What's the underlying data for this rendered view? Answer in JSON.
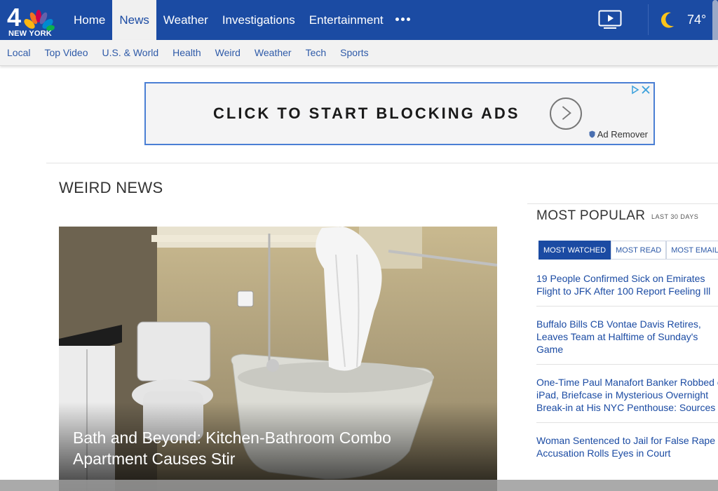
{
  "brand": {
    "logo_number": "4",
    "logo_city": "NEW YORK"
  },
  "main_nav": [
    {
      "label": "Home",
      "active": false
    },
    {
      "label": "News",
      "active": true
    },
    {
      "label": "Weather",
      "active": false
    },
    {
      "label": "Investigations",
      "active": false
    },
    {
      "label": "Entertainment",
      "active": false
    }
  ],
  "weather": {
    "icon": "moon-icon",
    "temp": "74°"
  },
  "sub_nav": [
    "Local",
    "Top Video",
    "U.S. & World",
    "Health",
    "Weird",
    "Weather",
    "Tech",
    "Sports"
  ],
  "ad": {
    "headline": "CLICK TO START BLOCKING ADS",
    "brand": "Ad Remover",
    "choice_icon": "adchoices-icon"
  },
  "section": {
    "title": "WEIRD NEWS"
  },
  "hero": {
    "caption": "Bath and Beyond: Kitchen-Bathroom Combo Apartment Causes Stir"
  },
  "most_popular": {
    "title": "MOST POPULAR",
    "subtitle": "LAST 30 DAYS",
    "tabs": [
      {
        "label": "MOST WATCHED",
        "active": true
      },
      {
        "label": "MOST READ",
        "active": false
      },
      {
        "label": "MOST EMAILED",
        "active": false
      }
    ],
    "items": [
      "19 People Confirmed Sick on Emirates Flight to JFK After 100 Report Feeling Ill",
      "Buffalo Bills CB Vontae Davis Retires, Leaves Team at Halftime of Sunday's Game",
      "One-Time Paul Manafort Banker Robbed of iPad, Briefcase in Mysterious Overnight Break-in at His NYC Penthouse: Sources",
      "Woman Sentenced to Jail for False Rape Accusation Rolls Eyes in Court"
    ]
  },
  "colors": {
    "brand_blue": "#1b4ba3",
    "link_blue": "#2e5aa8"
  }
}
